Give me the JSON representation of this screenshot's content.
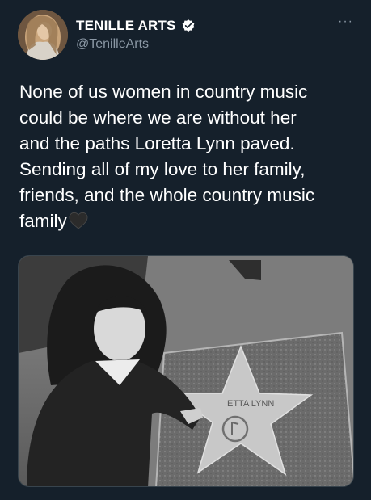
{
  "author": {
    "display_name": "TENILLE ARTS",
    "handle": "@TenilleArts",
    "verified": true,
    "avatar_icon": "profile-photo"
  },
  "menu": {
    "more_label": "···",
    "icon": "more-horizontal-icon"
  },
  "tweet": {
    "text": "None of us women in country music\ncould be where we are without her\nand the paths Loretta Lynn paved.\nSending all of my love to her family,\nfriends, and the whole country music\nfamily",
    "emoji": "black-heart-icon"
  },
  "media": {
    "description_icon": "photo-black-and-white",
    "star_text": "ETTA LYNN"
  },
  "colors": {
    "background": "#15202b",
    "text": "#ffffff",
    "secondary_text": "#8b98a5",
    "verified_badge": "#ffffff",
    "border": "#38444d"
  }
}
